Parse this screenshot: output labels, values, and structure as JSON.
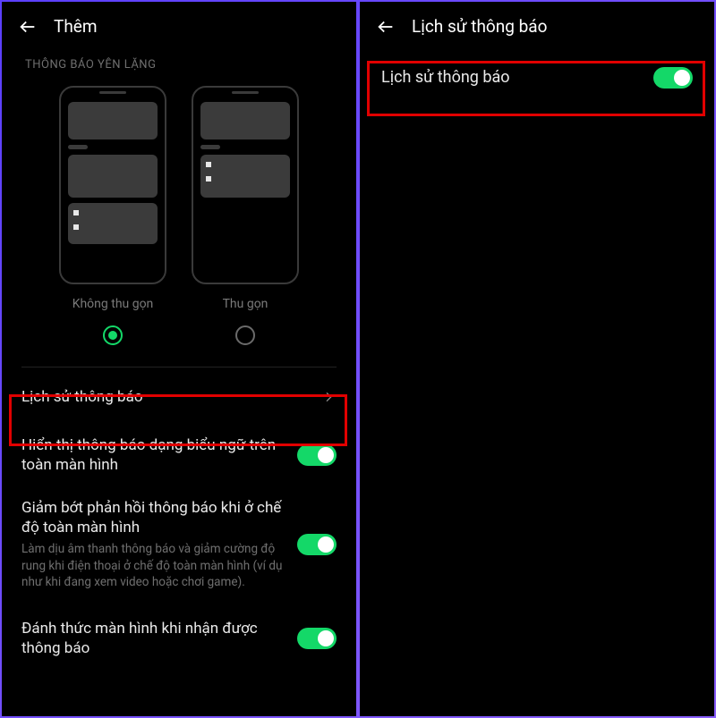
{
  "left": {
    "header": {
      "title": "Thêm"
    },
    "section_title": "THÔNG BÁO YÊN LẶNG",
    "options": {
      "no_collapse": "Không thu gọn",
      "collapse": "Thu gọn"
    },
    "rows": {
      "history": {
        "title": "Lịch sử thông báo"
      },
      "banner": {
        "title": "Hiển thị thông báo dạng biểu ngữ trên toàn màn hình"
      },
      "reduce": {
        "title": "Giảm bớt phản hồi thông báo khi ở chế độ toàn màn hình",
        "desc": "Làm dịu âm thanh thông báo và giảm cường độ rung khi điện thoại ở chế độ toàn màn hình (ví dụ như khi đang xem video hoặc chơi game)."
      },
      "wake": {
        "title": "Đánh thức màn hình khi nhận được thông báo"
      }
    }
  },
  "right": {
    "header": {
      "title": "Lịch sử thông báo"
    },
    "rows": {
      "history_toggle": {
        "title": "Lịch sử thông báo"
      }
    }
  }
}
